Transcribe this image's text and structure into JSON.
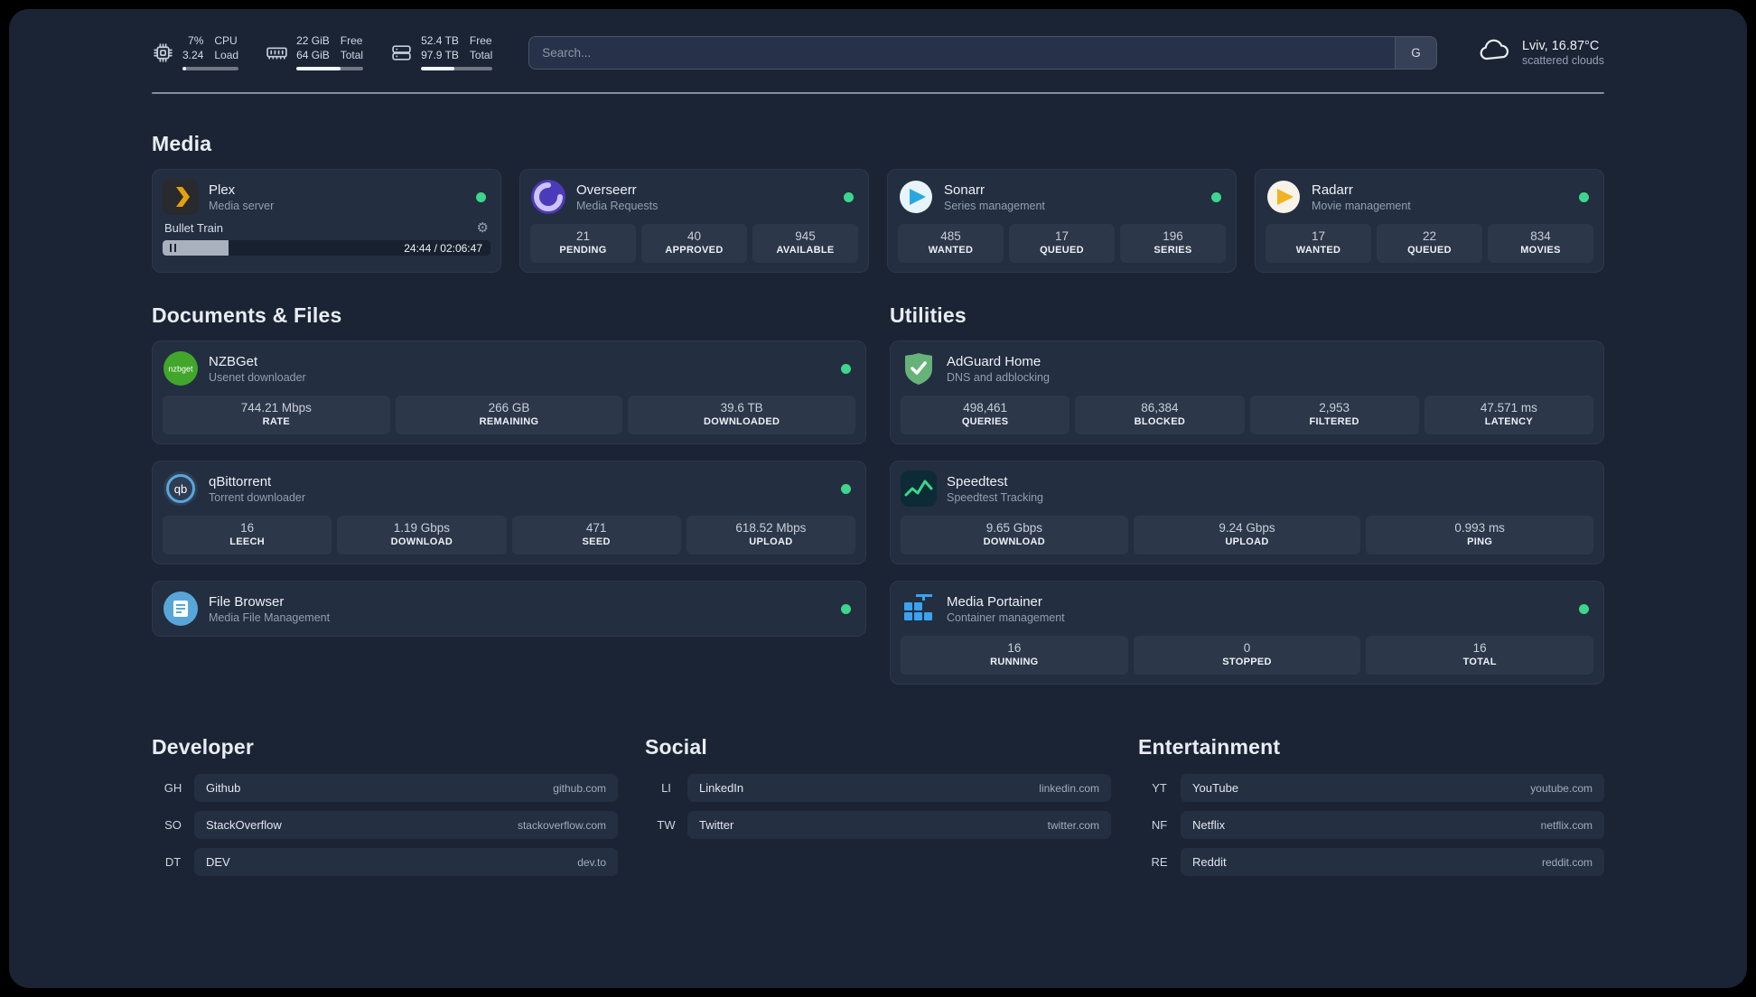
{
  "colors": {
    "status_online": "#3dd68c"
  },
  "topbar": {
    "cpu": {
      "icon": "cpu-icon",
      "value_top": "7%",
      "value_bottom": "3.24",
      "label_top": "CPU",
      "label_bottom": "Load",
      "bar_percent": 7
    },
    "memory": {
      "icon": "memory-icon",
      "value_top": "22 GiB",
      "value_bottom": "64 GiB",
      "label_top": "Free",
      "label_bottom": "Total",
      "bar_percent": 66
    },
    "disk": {
      "icon": "disk-icon",
      "value_top": "52.4 TB",
      "value_bottom": "97.9 TB",
      "label_top": "Free",
      "label_bottom": "Total",
      "bar_percent": 47
    },
    "search": {
      "placeholder": "Search...",
      "provider_label": "G"
    },
    "weather": {
      "icon": "cloud-icon",
      "location": "Lviv, 16.87°C",
      "condition": "scattered clouds"
    }
  },
  "groups": [
    {
      "title": "Media",
      "services": [
        {
          "name": "Plex",
          "description": "Media server",
          "status": "online",
          "icon": "plex-icon",
          "player": {
            "track": "Bullet Train",
            "time": "24:44 / 02:06:47",
            "progress_percent": 20
          }
        },
        {
          "name": "Overseerr",
          "description": "Media Requests",
          "status": "online",
          "icon": "overseerr-icon",
          "stats": [
            {
              "value": "21",
              "label": "PENDING"
            },
            {
              "value": "40",
              "label": "APPROVED"
            },
            {
              "value": "945",
              "label": "AVAILABLE"
            }
          ]
        },
        {
          "name": "Sonarr",
          "description": "Series management",
          "status": "online",
          "icon": "sonarr-icon",
          "stats": [
            {
              "value": "485",
              "label": "WANTED"
            },
            {
              "value": "17",
              "label": "QUEUED"
            },
            {
              "value": "196",
              "label": "SERIES"
            }
          ]
        },
        {
          "name": "Radarr",
          "description": "Movie management",
          "status": "online",
          "icon": "radarr-icon",
          "stats": [
            {
              "value": "17",
              "label": "WANTED"
            },
            {
              "value": "22",
              "label": "QUEUED"
            },
            {
              "value": "834",
              "label": "MOVIES"
            }
          ]
        }
      ]
    },
    {
      "title": "Documents & Files",
      "services": [
        {
          "name": "NZBGet",
          "description": "Usenet downloader",
          "status": "online",
          "icon": "nzbget-icon",
          "stats": [
            {
              "value": "744.21 Mbps",
              "label": "RATE"
            },
            {
              "value": "266 GB",
              "label": "REMAINING"
            },
            {
              "value": "39.6 TB",
              "label": "DOWNLOADED"
            }
          ]
        },
        {
          "name": "qBittorrent",
          "description": "Torrent downloader",
          "status": "online",
          "icon": "qbittorrent-icon",
          "stats": [
            {
              "value": "16",
              "label": "LEECH"
            },
            {
              "value": "1.19 Gbps",
              "label": "DOWNLOAD"
            },
            {
              "value": "471",
              "label": "SEED"
            },
            {
              "value": "618.52 Mbps",
              "label": "UPLOAD"
            }
          ]
        },
        {
          "name": "File Browser",
          "description": "Media File Management",
          "status": "online",
          "icon": "filebrowser-icon"
        }
      ]
    },
    {
      "title": "Utilities",
      "services": [
        {
          "name": "AdGuard Home",
          "description": "DNS and adblocking",
          "status": null,
          "icon": "adguard-icon",
          "stats": [
            {
              "value": "498,461",
              "label": "QUERIES"
            },
            {
              "value": "86,384",
              "label": "BLOCKED"
            },
            {
              "value": "2,953",
              "label": "FILTERED"
            },
            {
              "value": "47.571 ms",
              "label": "LATENCY"
            }
          ]
        },
        {
          "name": "Speedtest",
          "description": "Speedtest Tracking",
          "status": null,
          "icon": "speedtest-icon",
          "stats": [
            {
              "value": "9.65 Gbps",
              "label": "DOWNLOAD"
            },
            {
              "value": "9.24 Gbps",
              "label": "UPLOAD"
            },
            {
              "value": "0.993 ms",
              "label": "PING"
            }
          ]
        },
        {
          "name": "Media Portainer",
          "description": "Container management",
          "status": "online",
          "icon": "portainer-icon",
          "stats": [
            {
              "value": "16",
              "label": "RUNNING"
            },
            {
              "value": "0",
              "label": "STOPPED"
            },
            {
              "value": "16",
              "label": "TOTAL"
            }
          ]
        }
      ]
    }
  ],
  "bookmarks": [
    {
      "title": "Developer",
      "links": [
        {
          "abbr": "GH",
          "name": "Github",
          "domain": "github.com"
        },
        {
          "abbr": "SO",
          "name": "StackOverflow",
          "domain": "stackoverflow.com"
        },
        {
          "abbr": "DT",
          "name": "DEV",
          "domain": "dev.to"
        }
      ]
    },
    {
      "title": "Social",
      "links": [
        {
          "abbr": "LI",
          "name": "LinkedIn",
          "domain": "linkedin.com"
        },
        {
          "abbr": "TW",
          "name": "Twitter",
          "domain": "twitter.com"
        }
      ]
    },
    {
      "title": "Entertainment",
      "links": [
        {
          "abbr": "YT",
          "name": "YouTube",
          "domain": "youtube.com"
        },
        {
          "abbr": "NF",
          "name": "Netflix",
          "domain": "netflix.com"
        },
        {
          "abbr": "RE",
          "name": "Reddit",
          "domain": "reddit.com"
        }
      ]
    }
  ]
}
